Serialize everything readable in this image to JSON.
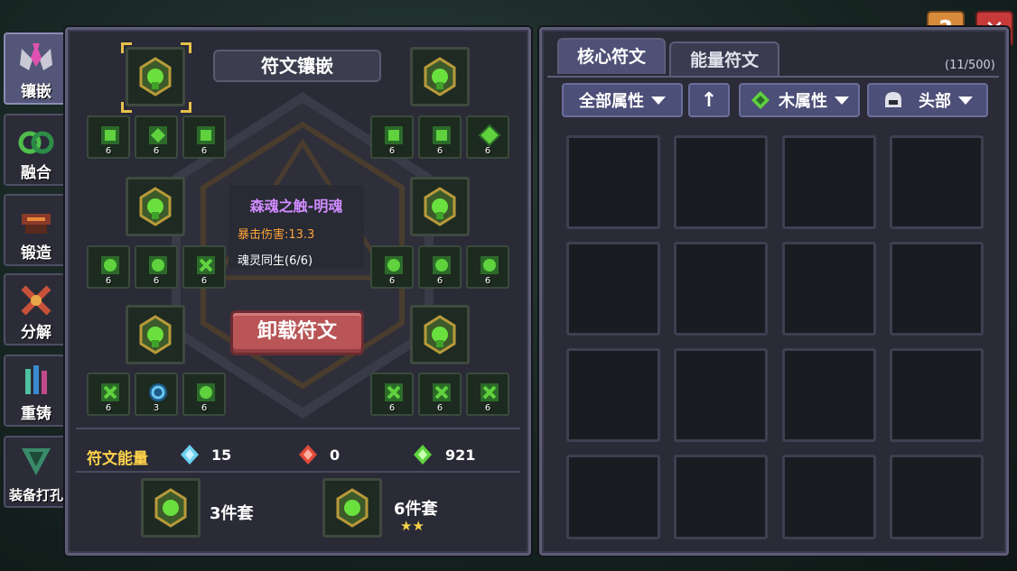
{
  "top_buttons": {
    "help": "?",
    "close": "✕"
  },
  "sidebar": [
    {
      "label": "镶嵌",
      "icon": "inlay-icon",
      "active": true
    },
    {
      "label": "融合",
      "icon": "fusion-icon",
      "active": false
    },
    {
      "label": "锻造",
      "icon": "forge-icon",
      "active": false
    },
    {
      "label": "分解",
      "icon": "dismantle-icon",
      "active": false
    },
    {
      "label": "重铸",
      "icon": "recast-icon",
      "active": false
    },
    {
      "label": "装备打孔",
      "icon": "socket-icon",
      "active": false
    }
  ],
  "left_panel": {
    "title": "符文镶嵌",
    "tooltip": {
      "name": "森魂之触-明魂",
      "stat": "暴击伤害:13.3",
      "set_bonus": "魂灵同生(6/6)"
    },
    "unload_button": "卸载符文",
    "rune_levels": [
      "6",
      "6",
      "6",
      "6",
      "6",
      "6",
      "6",
      "6",
      "6",
      "6",
      "6",
      "6",
      "6",
      "3",
      "6",
      "6",
      "6",
      "6"
    ],
    "energy": {
      "label": "符文能量",
      "blue": "15",
      "red": "0",
      "green": "921"
    },
    "sets": [
      {
        "label": "3件套",
        "stars": ""
      },
      {
        "label": "6件套",
        "stars": "★★"
      }
    ]
  },
  "right_panel": {
    "tabs": [
      {
        "label": "核心符文",
        "active": true
      },
      {
        "label": "能量符文",
        "active": false
      }
    ],
    "capacity": "(11/500)",
    "filters": {
      "all_attr": "全部属性",
      "sort": "↑",
      "element": "木属性",
      "slot": "头部"
    }
  },
  "colors": {
    "rune_green": "#5fd23e",
    "gold": "#e7c14a",
    "tooltip_name": "#d08cff",
    "tooltip_stat": "#ffa23a"
  }
}
